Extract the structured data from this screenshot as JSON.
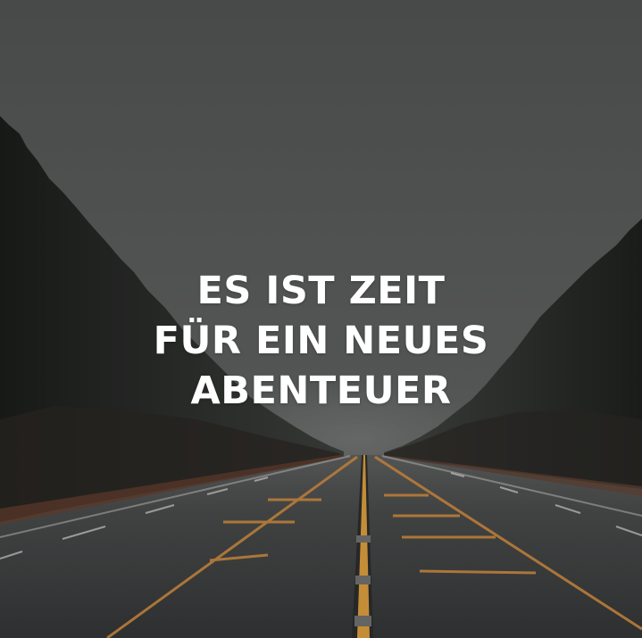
{
  "headline": {
    "lines": [
      "ES IST ZEIT",
      "FÜR EIN NEUES",
      "ABENTEUER"
    ]
  },
  "colors": {
    "sky": "#565858",
    "forest": "#1f221f",
    "road": "#3c3e3f",
    "center_line": "#d59a3c",
    "edge_line": "#c98a44",
    "text": "#ffffff"
  }
}
